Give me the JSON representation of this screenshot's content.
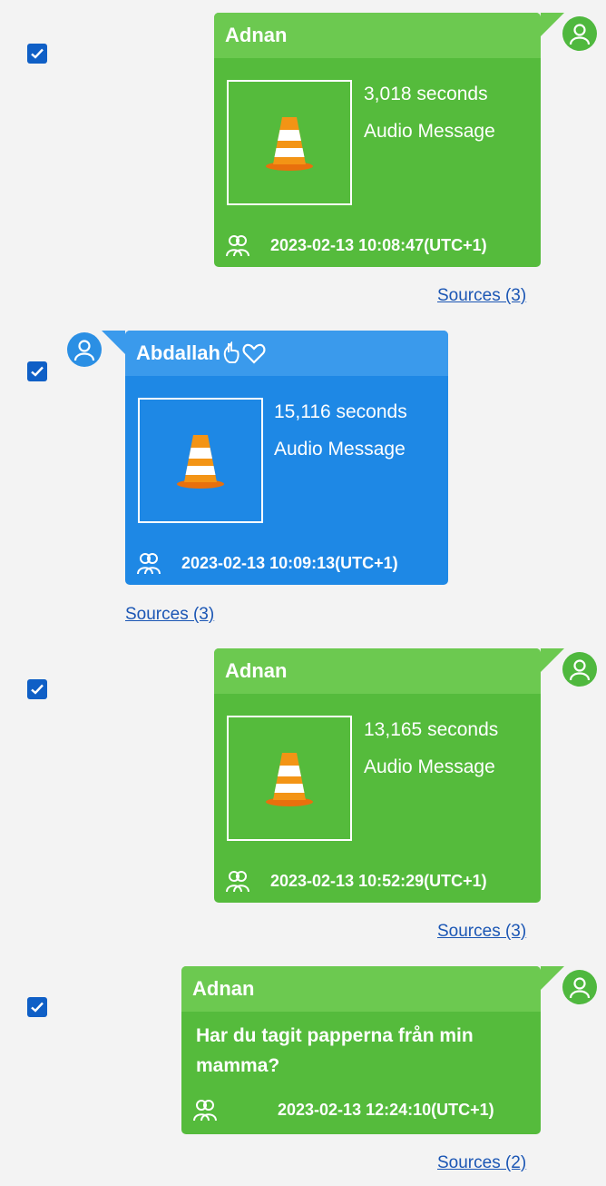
{
  "messages": [
    {
      "sender": "Adnan",
      "duration": "3,018 seconds",
      "kind": "Audio Message",
      "timestamp": "2023-02-13 10:08:47(UTC+1)",
      "sources": "Sources (3)",
      "checked": true
    },
    {
      "sender": "Abdallah",
      "duration": "15,116 seconds",
      "kind": "Audio Message",
      "timestamp": "2023-02-13 10:09:13(UTC+1)",
      "sources": "Sources (3)",
      "checked": true
    },
    {
      "sender": "Adnan",
      "duration": "13,165 seconds",
      "kind": "Audio Message",
      "timestamp": "2023-02-13 10:52:29(UTC+1)",
      "sources": "Sources (3)",
      "checked": true
    },
    {
      "sender": "Adnan",
      "text": "Har du tagit papperna från min mamma?",
      "timestamp": "2023-02-13 12:24:10(UTC+1)",
      "sources": "Sources (2)",
      "checked": true
    }
  ],
  "colors": {
    "outgoing_bubble": "#55bb3c",
    "outgoing_header": "#6cc950",
    "incoming_bubble": "#1e88e5",
    "incoming_header": "#3a9aec",
    "checkbox": "#0f5fc6",
    "link": "#1b56b4"
  },
  "icons": {
    "thumbnail": "vlc-cone-icon",
    "avatar": "user-icon",
    "group": "group-icon",
    "checkbox": "check-icon",
    "sender_decoration": [
      "hand-icon",
      "heart-outline-icon"
    ]
  }
}
